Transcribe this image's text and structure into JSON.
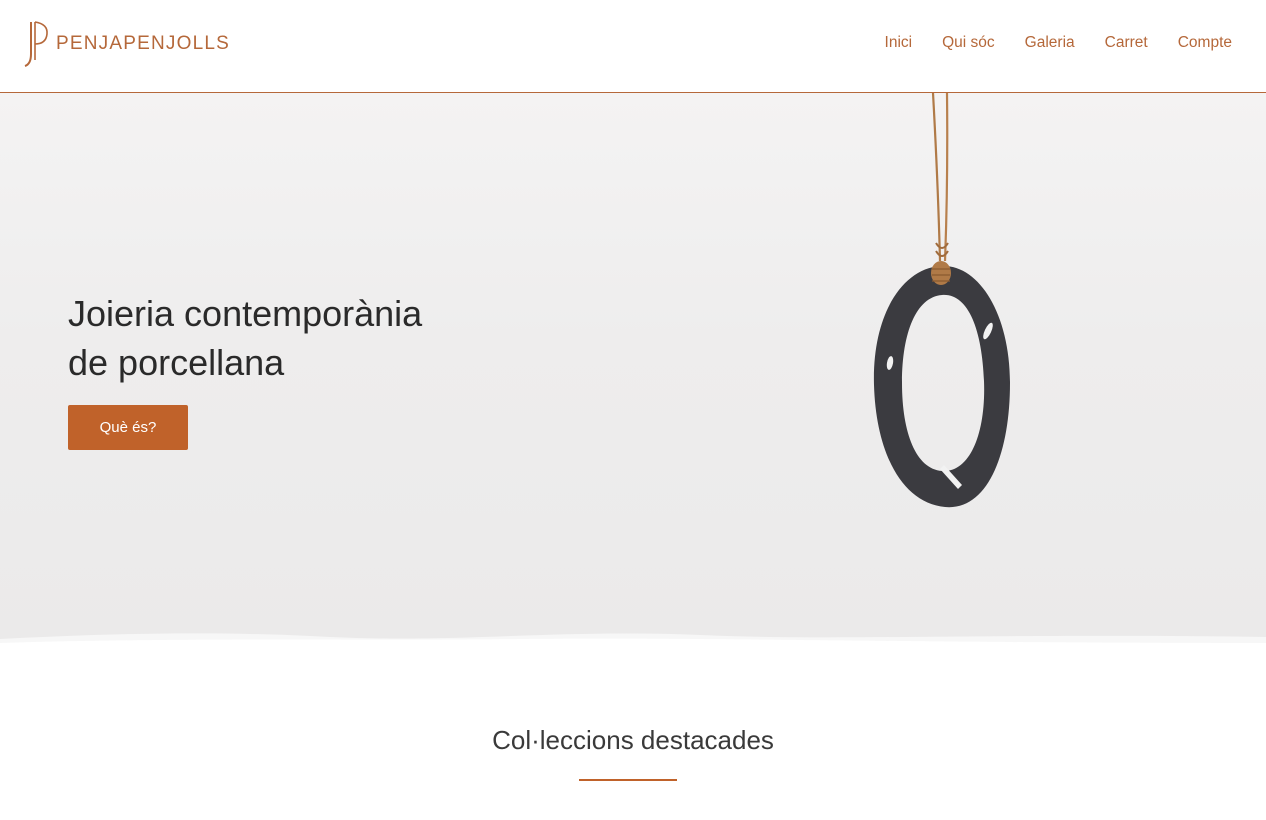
{
  "header": {
    "logo_text": "PENJAPENJOLLS",
    "nav": [
      "Inici",
      "Qui sóc",
      "Galeria",
      "Carret",
      "Compte"
    ]
  },
  "hero": {
    "title_line1": "Joieria contemporània",
    "title_line2": "de porcellana",
    "button_label": "Què és?"
  },
  "section": {
    "title": "Col·leccions destacades"
  },
  "colors": {
    "accent": "#c0622a",
    "nav_text": "#b5683a",
    "hero_bg": "#eeeded",
    "pendant": "#3b3b40"
  },
  "icons": {
    "logo_mark": "jp-monogram-icon"
  }
}
